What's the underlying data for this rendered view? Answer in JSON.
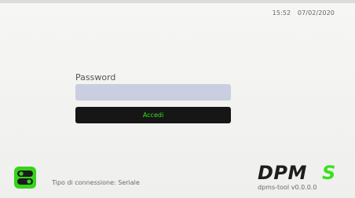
{
  "header": {
    "time": "15:52",
    "date": "07/02/2020"
  },
  "login": {
    "password_label": "Password",
    "password_value": "",
    "password_placeholder": "",
    "submit_label": "Accedi"
  },
  "footer": {
    "connection_text": "Tipo di connessione: Seriale",
    "connection_icon": "serial-toggle-icon",
    "brand_name": "DPMS",
    "version_text": "dpms-tool v0.0.0.0"
  },
  "colors": {
    "accent_green": "#37e21c",
    "button_bg": "#161616",
    "input_bg": "#c9cfe0",
    "brand_dark": "#1e1e1e"
  }
}
